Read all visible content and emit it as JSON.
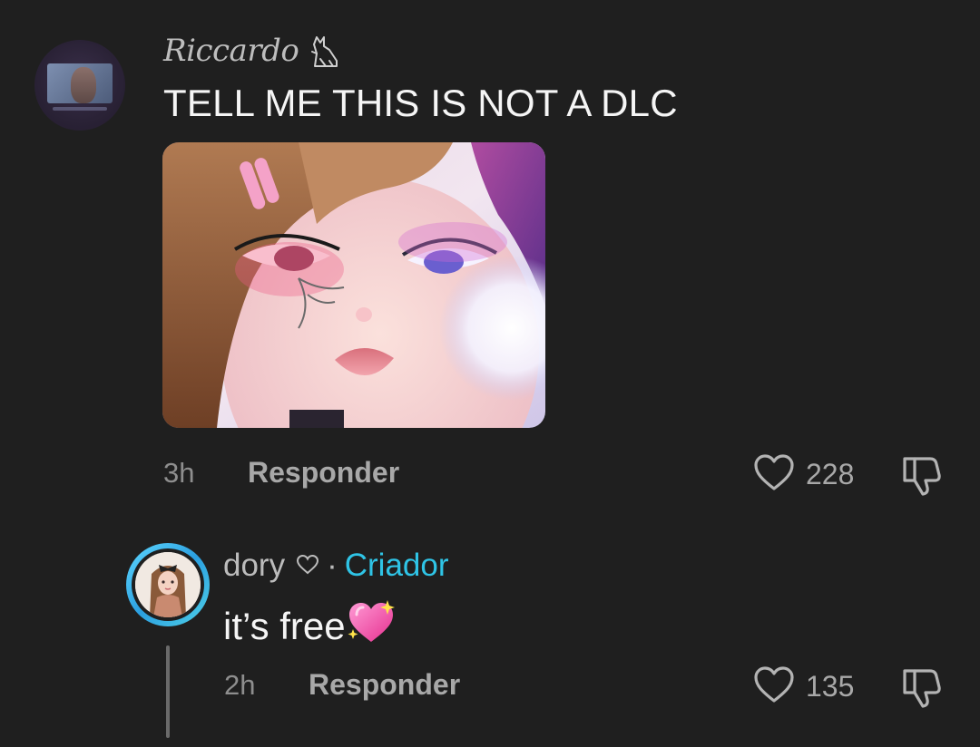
{
  "comment": {
    "username": "Riccardo",
    "username_badge_icon": "cat-icon",
    "text": "TELL ME THIS IS NOT A DLC",
    "image_icon": "comment-image",
    "time": "3h",
    "reply_label": "Responder",
    "likes": "228"
  },
  "reply": {
    "username": "dory",
    "separator": "·",
    "creator_label": "Criador",
    "text": "it’s free",
    "emoji_icon": "sparkling-heart-icon",
    "time": "2h",
    "reply_label": "Responder",
    "likes": "135"
  },
  "colors": {
    "background": "#1f1f1f",
    "creator": "#2fc4e6",
    "secondary_text": "#a8a8a8"
  }
}
